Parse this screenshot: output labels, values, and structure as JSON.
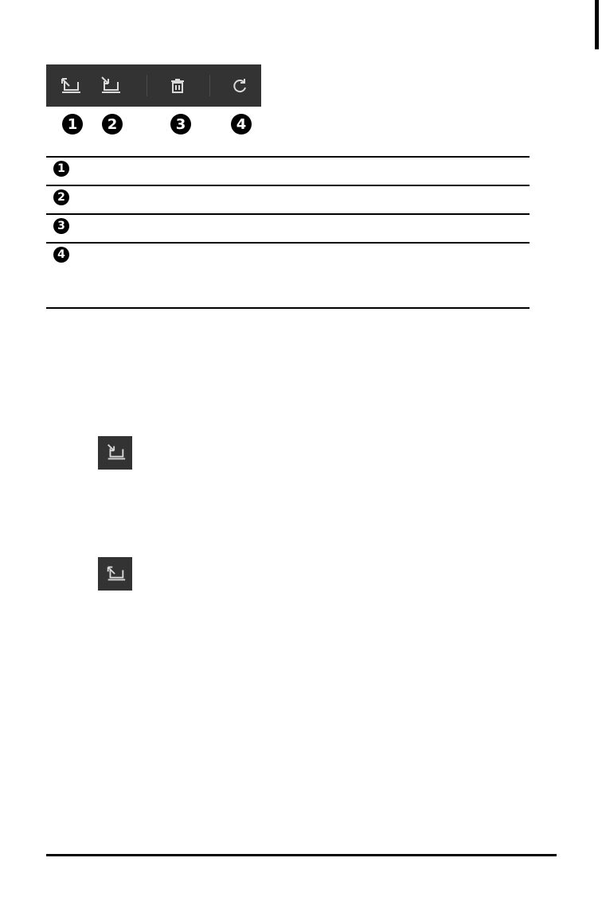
{
  "toolbar": {
    "buttons": [
      {
        "name": "upload-to-device",
        "icon": "laptop-arrow-out-icon"
      },
      {
        "name": "download-to-computer",
        "icon": "laptop-arrow-in-icon"
      },
      {
        "name": "delete",
        "icon": "trash-icon"
      },
      {
        "name": "refresh",
        "icon": "refresh-icon"
      }
    ]
  },
  "callouts": [
    "1",
    "2",
    "3",
    "4"
  ],
  "legend": {
    "rows": [
      {
        "num": "1",
        "text": ""
      },
      {
        "num": "2",
        "text": ""
      },
      {
        "num": "3",
        "text": ""
      },
      {
        "num": "4",
        "text": ""
      }
    ]
  },
  "colors": {
    "toolbar_bg": "#333333",
    "icon": "#d9d9d9"
  }
}
